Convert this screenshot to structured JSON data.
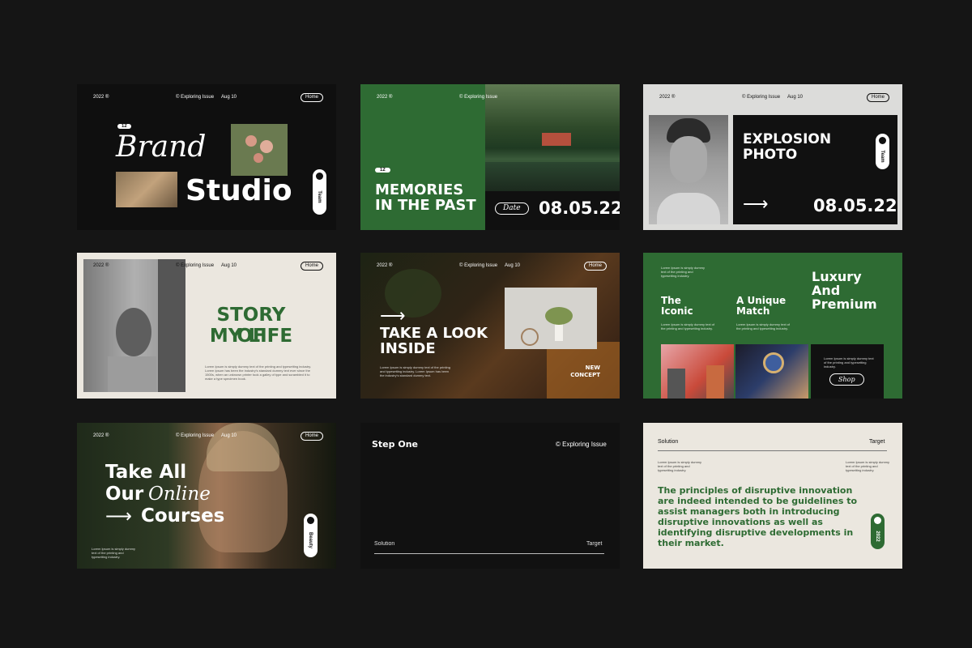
{
  "colors": {
    "background": "#151515",
    "green": "#2e6b33",
    "cream": "#ebe7df",
    "white": "#ffffff"
  },
  "header": {
    "year": "2022 ®",
    "issue": "© Exploring Issue",
    "date": "Aug 10",
    "home": "Home"
  },
  "s1": {
    "badge": "12",
    "brand": "Brand",
    "studio": "Studio",
    "toggle": "Team"
  },
  "s2": {
    "badge": "12",
    "title_line1": "MEMORIES",
    "title_line2": "IN THE PAST",
    "date_pill": "Date",
    "date": "08.05.22"
  },
  "s3": {
    "title_line1": "EXPLOSION",
    "title_line2": "PHOTO",
    "toggle": "Team",
    "date": "08.05.22",
    "arrow": "⟶"
  },
  "s4": {
    "title_line1": "STORY OF",
    "title_line2": "MY LIFE",
    "lorem": "Lorem Ipsum is simply dummy text of the printing and typesetting industry. Lorem Ipsum has been the industry's standard dummy text ever since the 1500s, when an unknown printer took a galley of type and scrambled it to make a type specimen book."
  },
  "s5": {
    "arrow": "⟶",
    "title_line1": "TAKE A LOOK",
    "title_line2": "INSIDE",
    "new_line1": "NEW",
    "new_line2": "CONCEPT",
    "lorem": "Lorem Ipsum is simply dummy text of the printing and typesetting industry. Lorem Ipsum has been the industry's standard dummy text."
  },
  "s6": {
    "lorem_top": "Lorem Ipsum is simply dummy text of the printing and typesetting industry.",
    "iconic_line1": "The",
    "iconic_line2": "Iconic",
    "unique_line1": "A Unique",
    "unique_line2": "Match",
    "lux_line1": "Luxury",
    "lux_line2": "And",
    "lux_line3": "Premium",
    "lorem_small": "Lorem Ipsum is simply dummy text of the printing and typesetting industry.",
    "shop": "Shop"
  },
  "s7": {
    "title_line1": "Take All",
    "title_line2a": "Our",
    "title_line2b": "Online",
    "title_line3": "Courses",
    "arrow": "⟶",
    "toggle": "Beauty",
    "lorem": "Lorem Ipsum is simply dummy text of the printing and typesetting industry."
  },
  "s8": {
    "step": "Step One",
    "issue": "© Exploring Issue",
    "solution": "Solution",
    "target": "Target"
  },
  "s9": {
    "solution": "Solution",
    "target": "Target",
    "lorem_left": "Lorem Ipsum is simply dummy text of the printing and typesetting industry.",
    "lorem_right": "Lorem Ipsum is simply dummy text of the printing and typesetting industry.",
    "quote_line1": "The principles of disruptive innovation",
    "quote_line2": "are indeed intended to be guidelines to",
    "quote_line3": "assist managers both in introducing",
    "quote_line4": "disruptive innovations as well as",
    "quote_line5": "identifying disruptive developments in",
    "quote_line6": "their market.",
    "toggle": "2022"
  }
}
